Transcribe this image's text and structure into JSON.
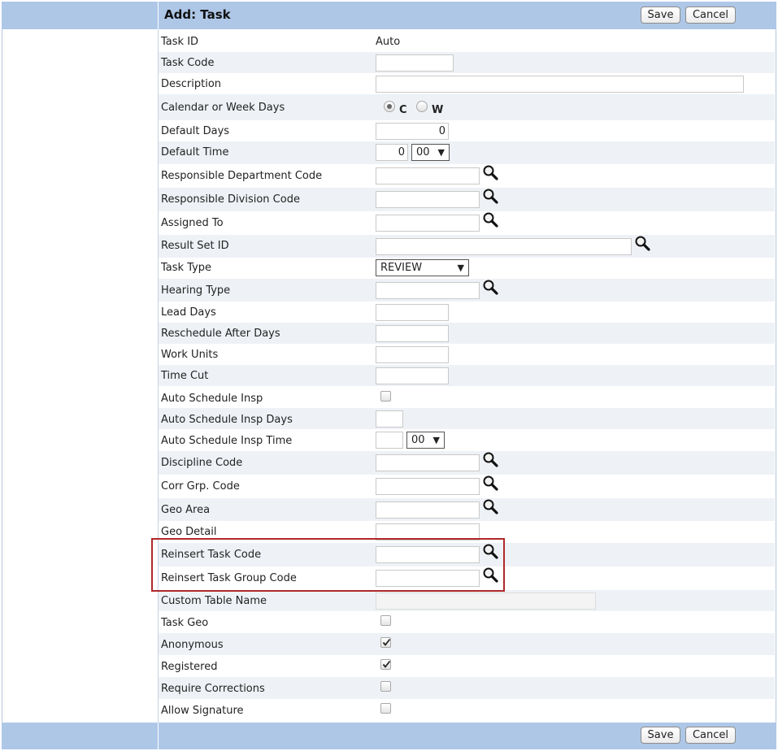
{
  "header": {
    "title": "Add: Task",
    "save_label": "Save",
    "cancel_label": "Cancel"
  },
  "footer": {
    "save_label": "Save",
    "cancel_label": "Cancel"
  },
  "fields": {
    "task_id": {
      "label": "Task ID",
      "value": "Auto"
    },
    "task_code": {
      "label": "Task Code",
      "value": ""
    },
    "description": {
      "label": "Description",
      "value": ""
    },
    "calendar_or_week_days": {
      "label": "Calendar or Week Days",
      "options": [
        "C",
        "W"
      ],
      "selected": "C"
    },
    "default_days": {
      "label": "Default Days",
      "value": "0"
    },
    "default_time": {
      "label": "Default Time",
      "hours": "0",
      "minutes": "00"
    },
    "responsible_department_code": {
      "label": "Responsible Department Code",
      "value": ""
    },
    "responsible_division_code": {
      "label": "Responsible Division Code",
      "value": ""
    },
    "assigned_to": {
      "label": "Assigned To",
      "value": ""
    },
    "result_set_id": {
      "label": "Result Set ID",
      "value": ""
    },
    "task_type": {
      "label": "Task Type",
      "selected": "REVIEW"
    },
    "hearing_type": {
      "label": "Hearing Type",
      "value": ""
    },
    "lead_days": {
      "label": "Lead Days",
      "value": ""
    },
    "reschedule_after_days": {
      "label": "Reschedule After Days",
      "value": ""
    },
    "work_units": {
      "label": "Work Units",
      "value": ""
    },
    "time_cut": {
      "label": "Time Cut",
      "value": ""
    },
    "auto_schedule_insp": {
      "label": "Auto Schedule Insp",
      "checked": false
    },
    "auto_schedule_insp_days": {
      "label": "Auto Schedule Insp Days",
      "value": ""
    },
    "auto_schedule_insp_time": {
      "label": "Auto Schedule Insp Time",
      "hours": "",
      "minutes": "00"
    },
    "discipline_code": {
      "label": "Discipline Code",
      "value": ""
    },
    "corr_grp_code": {
      "label": "Corr Grp. Code",
      "value": ""
    },
    "geo_area": {
      "label": "Geo Area",
      "value": ""
    },
    "geo_detail": {
      "label": "Geo Detail",
      "value": ""
    },
    "reinsert_task_code": {
      "label": "Reinsert Task Code",
      "value": ""
    },
    "reinsert_task_group_code": {
      "label": "Reinsert Task Group Code",
      "value": ""
    },
    "custom_table_name": {
      "label": "Custom Table Name",
      "value": ""
    },
    "task_geo": {
      "label": "Task Geo",
      "checked": false
    },
    "anonymous": {
      "label": "Anonymous",
      "checked": true
    },
    "registered": {
      "label": "Registered",
      "checked": true
    },
    "require_corrections": {
      "label": "Require Corrections",
      "checked": false
    },
    "allow_signature": {
      "label": "Allow Signature",
      "checked": false
    }
  },
  "icons": {
    "lookup": "magnifier-icon",
    "dropdown": "chevron-down-icon",
    "check": "checkmark-icon"
  },
  "colors": {
    "header_bg": "#aec7e7",
    "row_alt": "#eef2f6",
    "highlight_border": "#b0282a"
  }
}
